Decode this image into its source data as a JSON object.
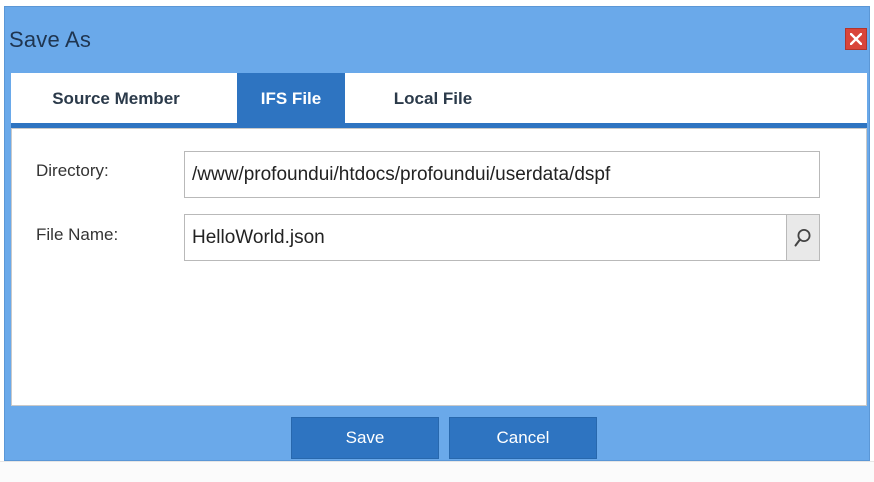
{
  "dialog": {
    "title": "Save As"
  },
  "tabs": [
    {
      "label": "Source Member",
      "active": false
    },
    {
      "label": "IFS File",
      "active": true
    },
    {
      "label": "Local File",
      "active": false
    }
  ],
  "form": {
    "directory_label": "Directory:",
    "directory_value": "/www/profoundui/htdocs/profoundui/userdata/dspf",
    "filename_label": "File Name:",
    "filename_value": "HelloWorld.json"
  },
  "buttons": {
    "save": "Save",
    "cancel": "Cancel"
  },
  "icons": {
    "close": "close-icon",
    "search": "search-icon"
  },
  "colors": {
    "dialog_bg": "#6aa9ea",
    "accent": "#2e74c1",
    "close": "#d9453a"
  }
}
